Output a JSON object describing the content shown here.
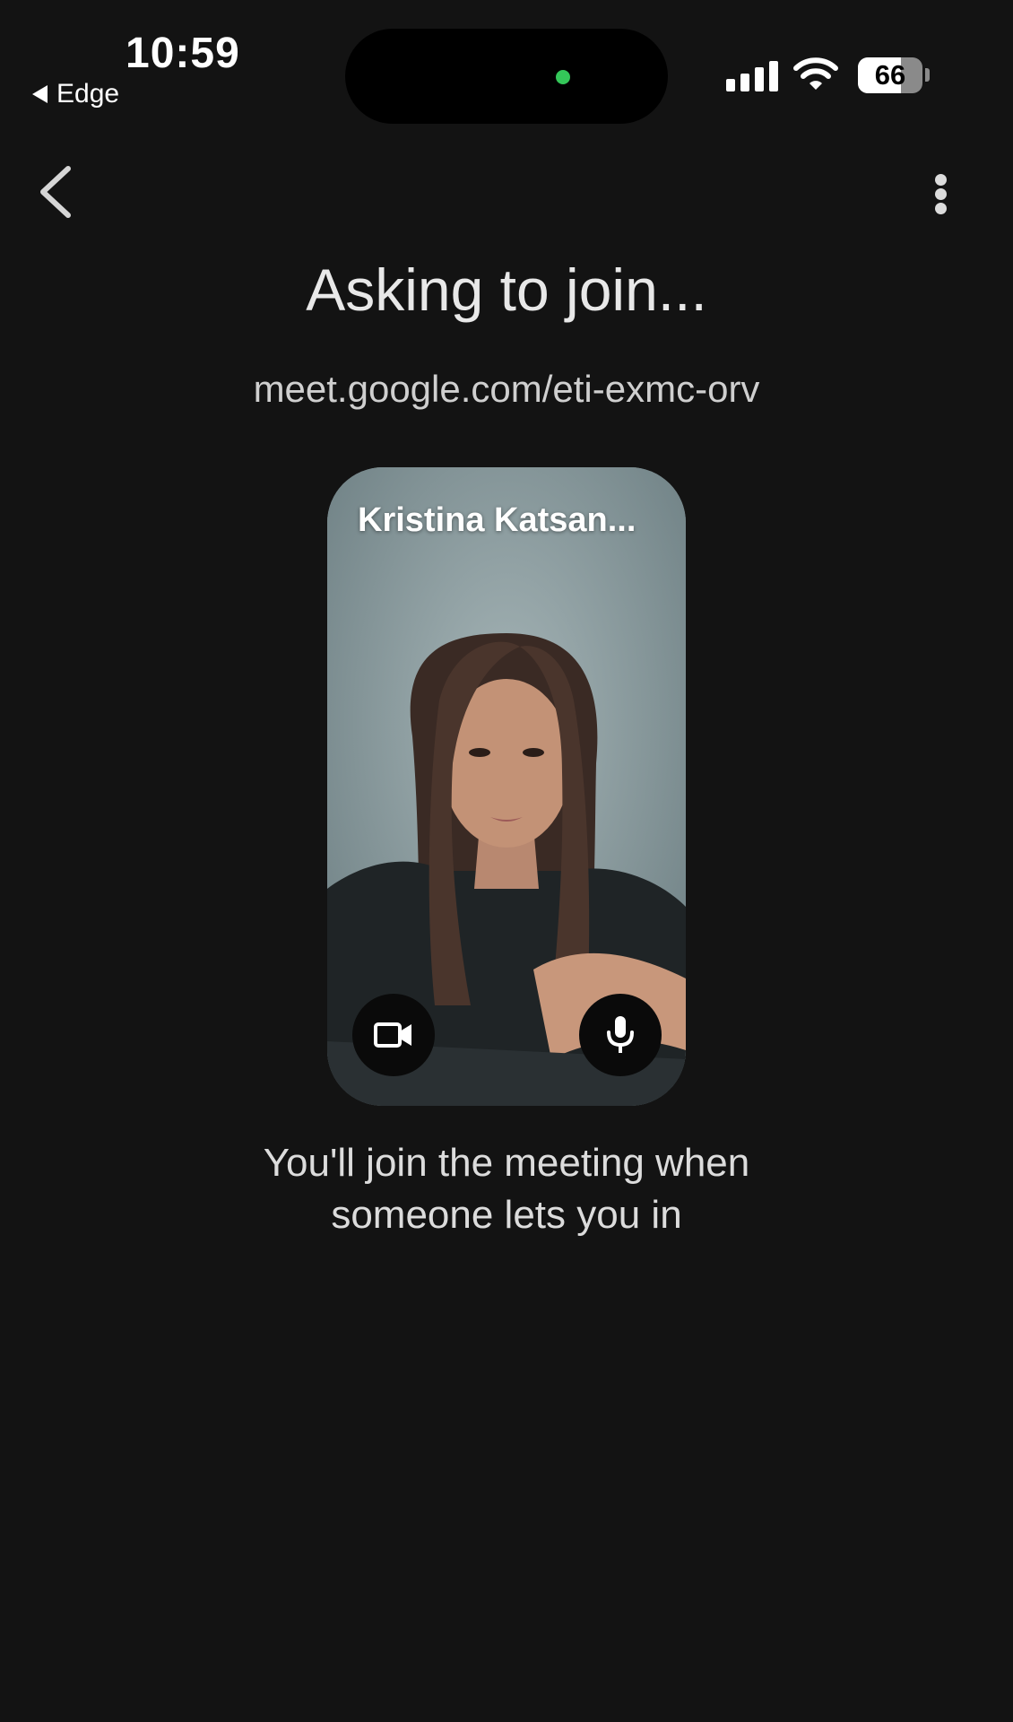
{
  "status_bar": {
    "time": "10:59",
    "back_app": "Edge",
    "battery_percent": "66",
    "battery_level": 0.66,
    "camera_indicator_color": "#34c759"
  },
  "app_bar": {
    "back_icon": "chevron-left-icon",
    "more_icon": "more-vert-icon"
  },
  "main": {
    "title": "Asking to join...",
    "meeting_url": "meet.google.com/eti-exmc-orv",
    "preview": {
      "participant_name": "Kristina Katsan...",
      "camera_icon": "videocam-icon",
      "mic_icon": "mic-icon"
    },
    "message_line1": "You'll join the meeting when",
    "message_line2": "someone lets you in"
  }
}
